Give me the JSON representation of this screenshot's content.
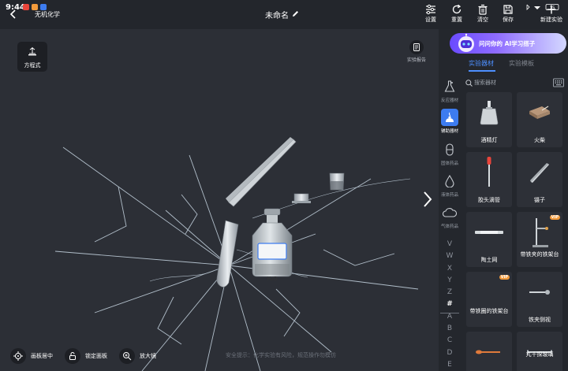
{
  "statusbar": {
    "time": "9:44",
    "battery": "15"
  },
  "header": {
    "app_title": "无机化学",
    "doc_title": "未命名",
    "actions": [
      {
        "id": "settings",
        "label": "设置"
      },
      {
        "id": "reset",
        "label": "重置"
      },
      {
        "id": "clear",
        "label": "清空"
      },
      {
        "id": "save",
        "label": "保存"
      },
      {
        "id": "new",
        "label": "新建实验"
      }
    ]
  },
  "canvas": {
    "equation_label": "方程式",
    "report_label": "实验报告",
    "bottle_label": "H₂O",
    "tools": [
      {
        "id": "center",
        "label": "画板居中"
      },
      {
        "id": "lock",
        "label": "锁定面板"
      },
      {
        "id": "zoom",
        "label": "放大镜"
      }
    ],
    "safety_tip": "安全提示：化学实验有风险，规范操作勿模仿"
  },
  "sidebar": {
    "ai_banner": "问问你的 AI学习搭子",
    "tabs": [
      {
        "id": "equipment",
        "label": "实验器材",
        "active": true
      },
      {
        "id": "templates",
        "label": "实验模板",
        "active": false
      }
    ],
    "categories": [
      {
        "id": "reaction",
        "label": "反应器材",
        "active": false
      },
      {
        "id": "auxiliary",
        "label": "辅助器材",
        "active": true
      },
      {
        "id": "solid",
        "label": "固体药品",
        "active": false
      },
      {
        "id": "liquid",
        "label": "液体药品",
        "active": false
      },
      {
        "id": "gas",
        "label": "气体药品",
        "active": false
      }
    ],
    "search_placeholder": "搜索器材",
    "alpha_index": [
      "V",
      "W",
      "X",
      "Y",
      "Z",
      "#",
      "A",
      "B",
      "C",
      "D",
      "E"
    ],
    "items": [
      {
        "name": "酒精灯",
        "vip": false
      },
      {
        "name": "火柴",
        "vip": false
      },
      {
        "name": "胶头滴管",
        "vip": false
      },
      {
        "name": "镊子",
        "vip": false
      },
      {
        "name": "陶土网",
        "vip": false
      },
      {
        "name": "带铁夹的铁架台",
        "vip": true
      },
      {
        "name": "带铁圈的铁架台",
        "vip": true
      },
      {
        "name": "铁夹侧视",
        "vip": false
      },
      {
        "name": "",
        "vip": false
      },
      {
        "name": "丸十探玻璃",
        "vip": false
      }
    ],
    "vip_label": "VIP",
    "accent": "#3d7cf0"
  }
}
